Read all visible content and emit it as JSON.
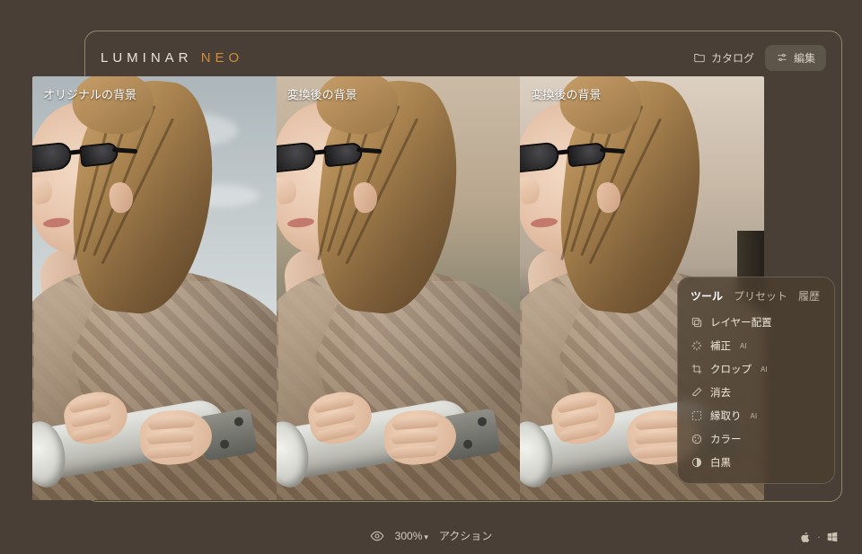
{
  "brand": {
    "word1": "LUMINAR",
    "word2": "NEO"
  },
  "topnav": {
    "catalog": "カタログ",
    "edit": "編集"
  },
  "panels": {
    "p1": "オリジナルの背景",
    "p2": "変換後の背景",
    "p3": "変換後の背景"
  },
  "popover": {
    "tabs": {
      "tools": "ツール",
      "presets": "プリセット",
      "history": "履歴"
    },
    "items": {
      "layer": {
        "label": "レイヤー配置",
        "ai": ""
      },
      "enhance": {
        "label": "補正",
        "ai": "AI"
      },
      "crop": {
        "label": "クロップ",
        "ai": "AI"
      },
      "erase": {
        "label": "消去",
        "ai": ""
      },
      "cutout": {
        "label": "縁取り",
        "ai": "AI"
      },
      "color": {
        "label": "カラー",
        "ai": ""
      },
      "bw": {
        "label": "白黒",
        "ai": ""
      }
    }
  },
  "status": {
    "zoom": "300%",
    "action": "アクション"
  }
}
